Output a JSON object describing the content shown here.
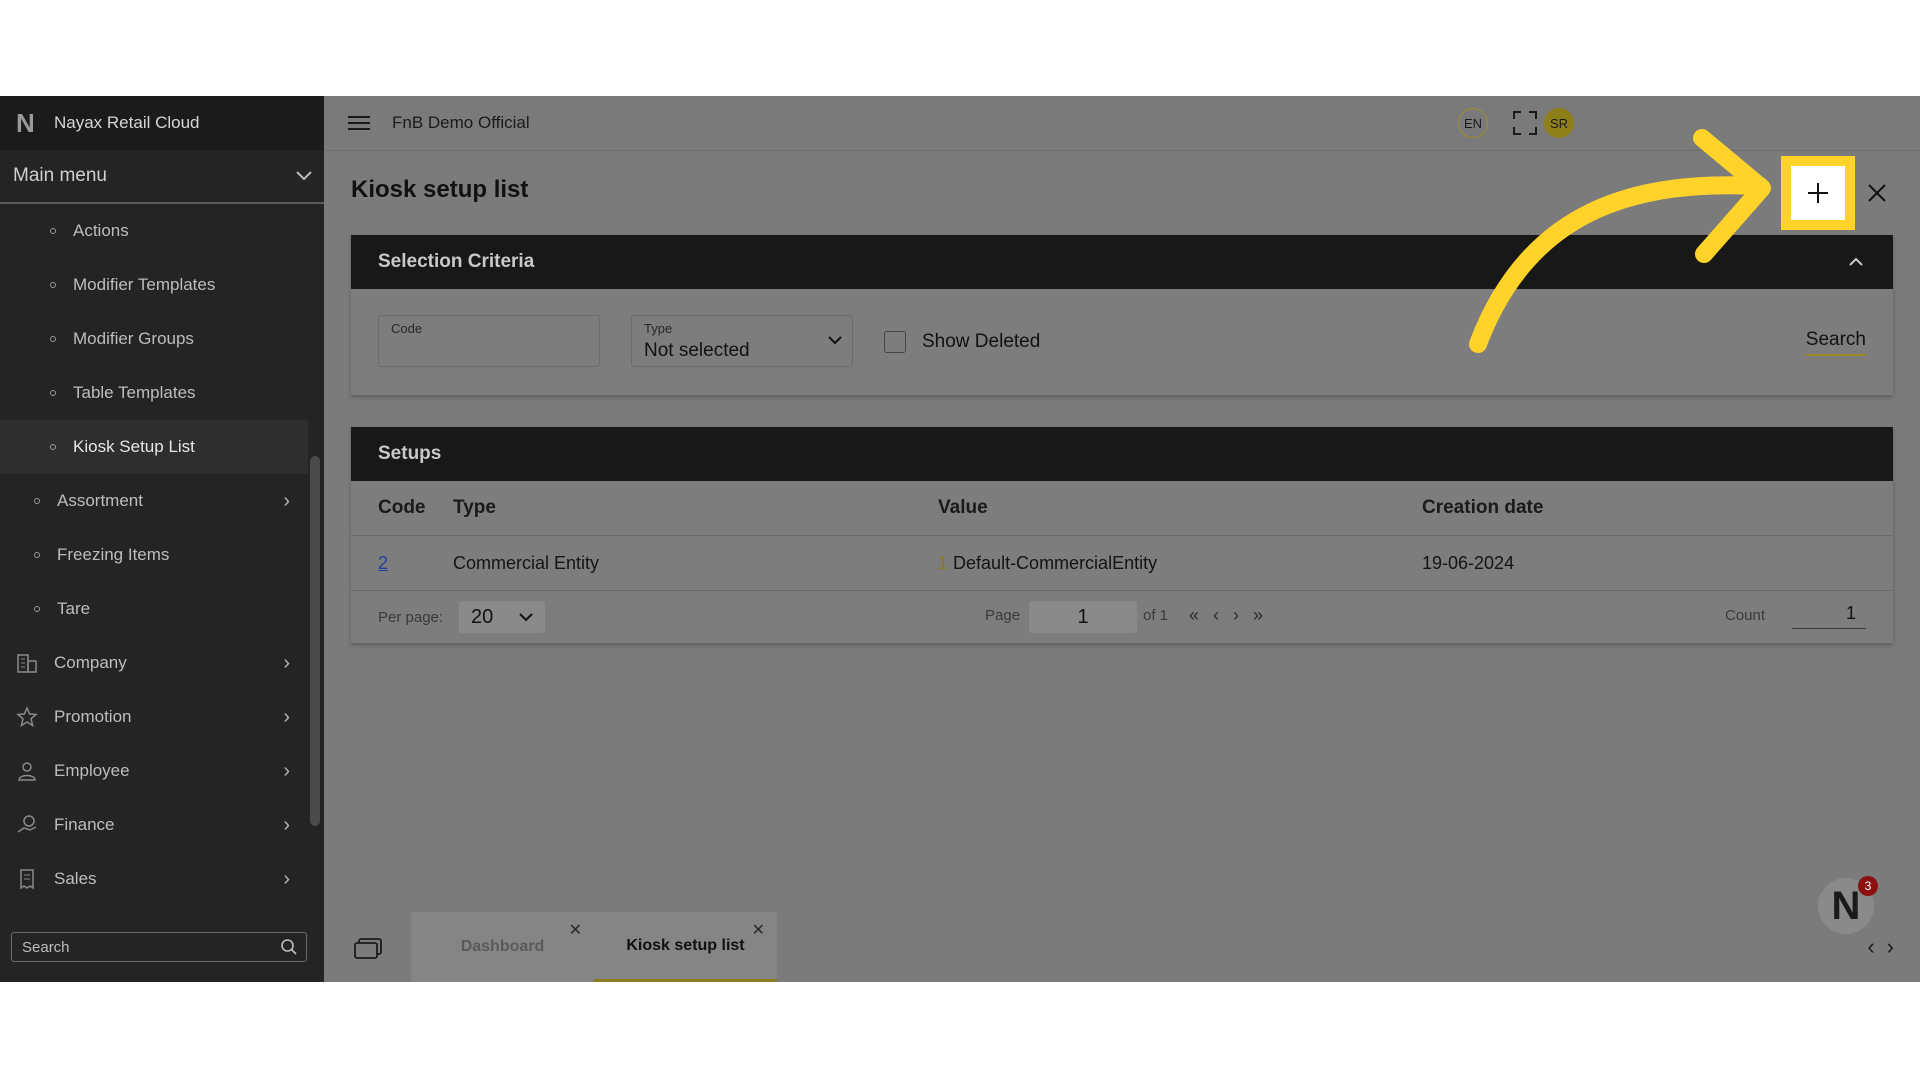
{
  "brand": {
    "name": "Nayax Retail Cloud",
    "logo": "N"
  },
  "sidebar": {
    "main_menu_label": "Main menu",
    "items": [
      {
        "label": "Actions",
        "level": "sub"
      },
      {
        "label": "Modifier Templates",
        "level": "sub"
      },
      {
        "label": "Modifier Groups",
        "level": "sub"
      },
      {
        "label": "Table Templates",
        "level": "sub"
      },
      {
        "label": "Kiosk Setup List",
        "level": "sub",
        "active": true
      },
      {
        "label": "Assortment",
        "level": "sub2"
      },
      {
        "label": "Freezing Items",
        "level": "sub2"
      },
      {
        "label": "Tare",
        "level": "sub2"
      },
      {
        "label": "Company",
        "icon": "building-icon"
      },
      {
        "label": "Promotion",
        "icon": "star-icon"
      },
      {
        "label": "Employee",
        "icon": "person-icon"
      },
      {
        "label": "Finance",
        "icon": "finance-icon"
      },
      {
        "label": "Sales",
        "icon": "receipt-icon"
      }
    ],
    "search_placeholder": "Search"
  },
  "topbar": {
    "company": "FnB Demo Official",
    "lang": "EN",
    "avatar": "SR"
  },
  "page": {
    "title": "Kiosk setup list"
  },
  "criteria": {
    "title": "Selection Criteria",
    "code_label": "Code",
    "code_value": "",
    "type_label": "Type",
    "type_value": "Not selected",
    "show_deleted": "Show Deleted",
    "search": "Search"
  },
  "setups": {
    "title": "Setups",
    "columns": [
      "Code",
      "Type",
      "Value",
      "Creation date"
    ],
    "rows": [
      {
        "code": "2",
        "type": "Commercial Entity",
        "value_num": "1",
        "value_text": "Default-CommercialEntity",
        "date": "19-06-2024"
      }
    ]
  },
  "pager": {
    "per_page_label": "Per page:",
    "per_page": "20",
    "page_label": "Page",
    "page": "1",
    "of": "of 1",
    "count_label": "Count",
    "count": "1"
  },
  "tabs": [
    {
      "label": "Dashboard"
    },
    {
      "label": "Kiosk setup list"
    }
  ],
  "notifications": {
    "count": "3"
  },
  "colors": {
    "highlight": "#ffd32a",
    "sidebar": "#242424",
    "accent": "#9a8a22"
  }
}
